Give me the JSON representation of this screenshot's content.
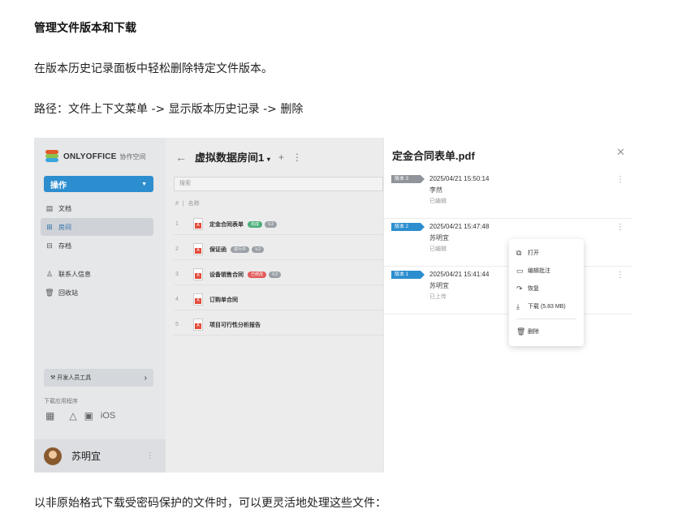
{
  "doc": {
    "title": "管理文件版本和下载",
    "intro": "在版本历史记录面板中轻松删除特定文件版本。",
    "path": "路径：文件上下文菜单 -> 显示版本历史记录 -> 删除",
    "footer": "以非原始格式下载受密码保护的文件时，可以更灵活地处理这些文件："
  },
  "sidebar": {
    "brand": "ONLYOFFICE",
    "brand_sub": "协作空间",
    "action_label": "操作",
    "items": [
      {
        "label": "文档",
        "icon": "document-icon"
      },
      {
        "label": "房间",
        "icon": "room-icon"
      },
      {
        "label": "存档",
        "icon": "archive-icon"
      },
      {
        "label": "联系人信息",
        "icon": "contacts-icon"
      },
      {
        "label": "回收站",
        "icon": "trash-icon"
      }
    ],
    "dev_tools": "开发人员工具",
    "download_apps": "下载应用程序",
    "ios_label": "iOS",
    "user_name": "苏明宜"
  },
  "main": {
    "room_title": "虚拟数据房间1",
    "search_placeholder": "搜索",
    "col_num": "#",
    "col_name": "名称",
    "files": [
      {
        "num": "1",
        "name": "定金合同表单",
        "tags": [
          {
            "text": "完成",
            "color": "green"
          },
          {
            "text": "V.2",
            "color": "gray"
          }
        ]
      },
      {
        "num": "2",
        "name": "保证函",
        "tags": [
          {
            "text": "进行中",
            "color": "gray"
          },
          {
            "text": "V.2",
            "color": "gray"
          }
        ]
      },
      {
        "num": "3",
        "name": "设备销售合同",
        "tags": [
          {
            "text": "已修改",
            "color": "red"
          },
          {
            "text": "V.2",
            "color": "gray"
          }
        ]
      },
      {
        "num": "4",
        "name": "订购单合同",
        "tags": []
      },
      {
        "num": "5",
        "name": "项目可行性分析报告",
        "tags": []
      }
    ]
  },
  "panel": {
    "title": "定金合同表单.pdf",
    "versions": [
      {
        "badge": "版本 3",
        "badge_color": "gray",
        "datetime": "2025/04/21 15:50:14",
        "author": "李然",
        "status": "已编辑"
      },
      {
        "badge": "版本 2",
        "badge_color": "blue",
        "datetime": "2025/04/21 15:47:48",
        "author": "苏明宜",
        "status": "已编辑"
      },
      {
        "badge": "版本 1",
        "badge_color": "blue",
        "datetime": "2025/04/21 15:41:44",
        "author": "苏明宜",
        "status": "已上传"
      }
    ]
  },
  "context_menu": {
    "open": "打开",
    "edit_comment": "编辑批注",
    "restore": "恢复",
    "download": "下载 (5.83 MB)",
    "delete": "删除"
  }
}
